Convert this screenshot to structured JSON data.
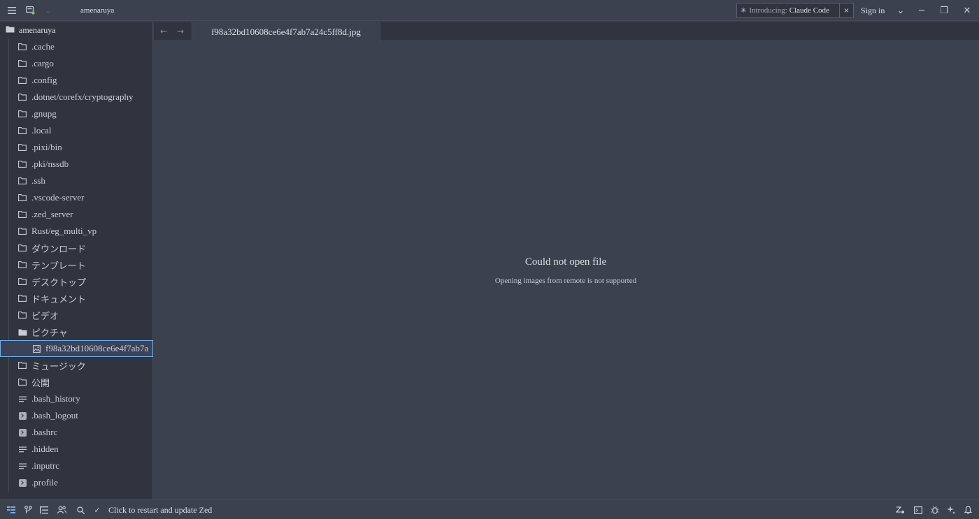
{
  "titlebar": {
    "project_name": "amenaruya",
    "promo_prefix": "Introducing:",
    "promo_main": "Claude Code",
    "promo_close": "×",
    "signin_label": "Sign in",
    "icons": {
      "menu": "≡",
      "remote": "▣",
      "dropdown": "⌄",
      "minimize": "─",
      "restore": "❐",
      "close": "✕",
      "spark": "✳"
    }
  },
  "project_panel": {
    "root": "amenaruya",
    "items": [
      {
        "label": ".cache",
        "type": "folder"
      },
      {
        "label": ".cargo",
        "type": "folder"
      },
      {
        "label": ".config",
        "type": "folder"
      },
      {
        "label": ".dotnet/corefx/cryptography",
        "type": "folder"
      },
      {
        "label": ".gnupg",
        "type": "folder"
      },
      {
        "label": ".local",
        "type": "folder"
      },
      {
        "label": ".pixi/bin",
        "type": "folder"
      },
      {
        "label": ".pki/nssdb",
        "type": "folder"
      },
      {
        "label": ".ssh",
        "type": "folder"
      },
      {
        "label": ".vscode-server",
        "type": "folder"
      },
      {
        "label": ".zed_server",
        "type": "folder"
      },
      {
        "label": "Rust/eg_multi_vp",
        "type": "folder"
      },
      {
        "label": "ダウンロード",
        "type": "folder"
      },
      {
        "label": "テンプレート",
        "type": "folder"
      },
      {
        "label": "デスクトップ",
        "type": "folder"
      },
      {
        "label": "ドキュメント",
        "type": "folder"
      },
      {
        "label": "ビデオ",
        "type": "folder"
      },
      {
        "label": "ピクチャ",
        "type": "folder-open"
      },
      {
        "label": "f98a32bd10608ce6e4f7ab7a",
        "type": "image"
      },
      {
        "label": "ミュージック",
        "type": "folder"
      },
      {
        "label": "公開",
        "type": "folder"
      },
      {
        "label": ".bash_history",
        "type": "text"
      },
      {
        "label": ".bash_logout",
        "type": "terminal"
      },
      {
        "label": ".bashrc",
        "type": "terminal"
      },
      {
        "label": ".hidden",
        "type": "text"
      },
      {
        "label": ".inputrc",
        "type": "text"
      },
      {
        "label": ".profile",
        "type": "terminal"
      }
    ]
  },
  "tabs": {
    "active_tab": "f98a32bd10608ce6e4f7ab7a24c5ff8d.jpg",
    "back_icon": "←",
    "forward_icon": "→"
  },
  "editor": {
    "error_title": "Could not open file",
    "error_message": "Opening images from remote is not supported"
  },
  "statusbar": {
    "check_icon": "✓",
    "update_text": "Click to restart and update Zed"
  },
  "colors": {
    "background": "#3b414d",
    "panel": "#2f343e",
    "border": "#464b57",
    "accent": "#74ade8",
    "selection": "#3a4359"
  }
}
